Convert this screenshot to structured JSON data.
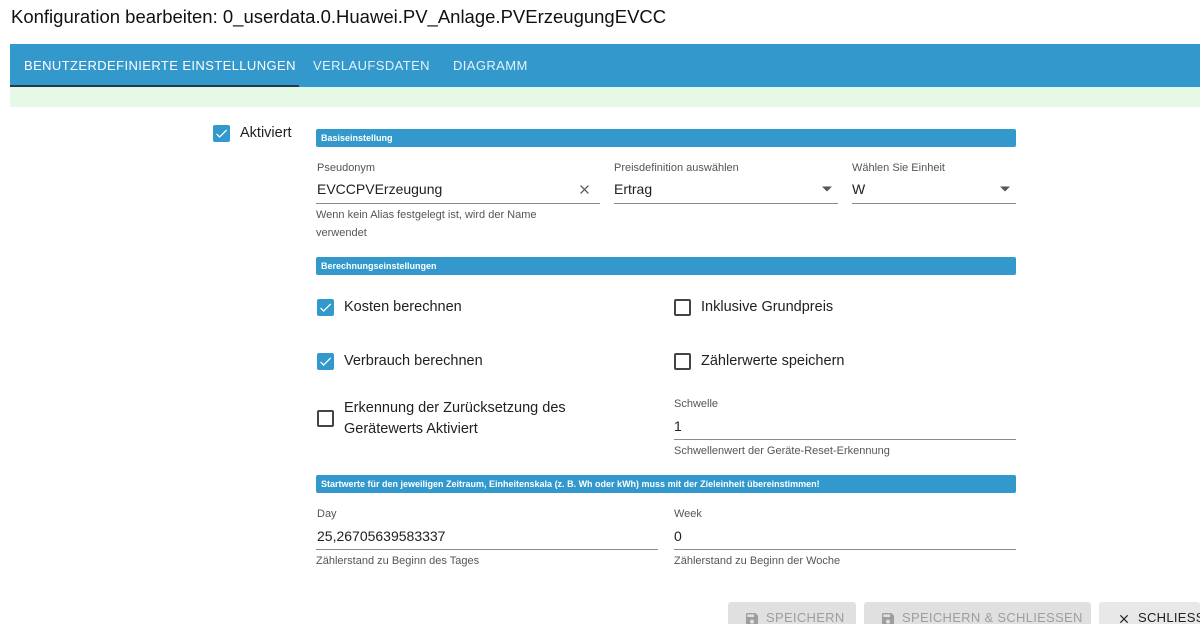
{
  "dialog": {
    "title": "Konfiguration bearbeiten: 0_userdata.0.Huawei.PV_Anlage.PVErzeugungEVCC"
  },
  "tabs": [
    {
      "label": "BENUTZERDEFINIERTE EINSTELLUNGEN",
      "active": true
    },
    {
      "label": "VERLAUFSDATEN",
      "active": false
    },
    {
      "label": "DIAGRAMM",
      "active": false
    }
  ],
  "activated": {
    "label": "Aktiviert",
    "checked": true
  },
  "base_section": {
    "title": "Basiseinstellung",
    "pseudonym": {
      "label": "Pseudonym",
      "value": "EVCCPVErzeugung",
      "helper": "Wenn kein Alias festgelegt ist, wird der Name verwendet"
    },
    "price": {
      "label": "Preisdefinition auswählen",
      "value": "Ertrag"
    },
    "unit": {
      "label": "Wählen Sie Einheit",
      "value": "W"
    }
  },
  "calc_section": {
    "title": "Berechnungseinstellungen",
    "costs": {
      "label": "Kosten berechnen",
      "checked": true
    },
    "base_price": {
      "label": "Inklusive Grundpreis",
      "checked": false
    },
    "consumption": {
      "label": "Verbrauch berechnen",
      "checked": true
    },
    "meter_values": {
      "label": "Zählerwerte speichern",
      "checked": false
    },
    "reset_detection": {
      "line1": "Erkennung der Zurücksetzung des",
      "line2": "Gerätewerts Aktiviert",
      "checked": false
    },
    "threshold": {
      "label": "Schwelle",
      "value": "1",
      "helper": "Schwellenwert der Geräte-Reset-Erkennung"
    }
  },
  "start_section": {
    "title": "Startwerte für den jeweiligen Zeitraum, Einheitenskala (z. B. Wh oder kWh) muss mit der Zieleinheit übereinstimmen!",
    "day": {
      "label": "Day",
      "value": "25,26705639583337",
      "helper": "Zählerstand zu Beginn des Tages"
    },
    "week": {
      "label": "Week",
      "value": "0",
      "helper": "Zählerstand zu Beginn der Woche"
    }
  },
  "buttons": {
    "save": "SPEICHERN",
    "save_close": "SPEICHERN & SCHLIESSEN",
    "close": "SCHLIESSEN"
  },
  "colors": {
    "accent": "#3399cc",
    "tab_indicator": "#233a4c",
    "success_strip": "#e6f8e6"
  },
  "icons": [
    "check-icon",
    "clear-icon",
    "dropdown-arrow-icon",
    "save-icon",
    "close-icon"
  ]
}
